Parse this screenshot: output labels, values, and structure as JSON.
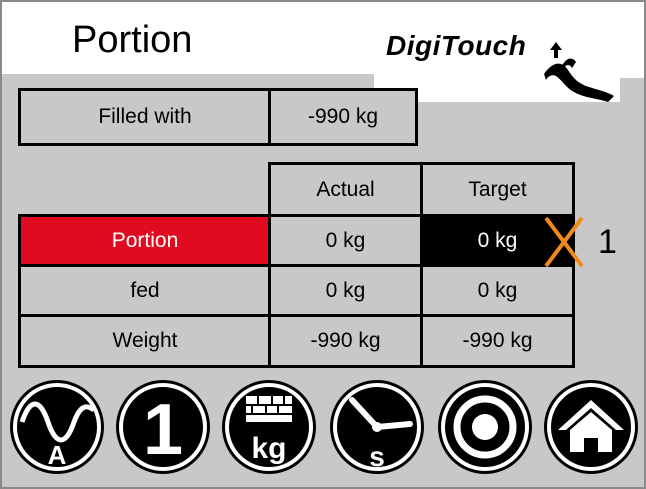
{
  "header": {
    "title": "Portion",
    "brand": "DigiTouch"
  },
  "filled": {
    "label": "Filled with",
    "value": "-990 kg"
  },
  "table": {
    "columns": [
      "Actual",
      "Target"
    ],
    "rows": [
      {
        "label": "Portion",
        "actual": "0 kg",
        "target": "0 kg"
      },
      {
        "label": "fed",
        "actual": "0 kg",
        "target": "0 kg"
      },
      {
        "label": "Weight",
        "actual": "-990 kg",
        "target": "-990 kg"
      }
    ]
  },
  "annotation": {
    "label": "1",
    "color": "#f08a1c"
  },
  "toolbar": {
    "buttons": [
      {
        "icon": "sine-ampere-icon",
        "label": "A"
      },
      {
        "icon": "number-one-icon",
        "label": "1"
      },
      {
        "icon": "bricks-kg-icon",
        "label": "kg"
      },
      {
        "icon": "clock-seconds-icon",
        "label": "s"
      },
      {
        "icon": "target-icon"
      },
      {
        "icon": "home-icon"
      }
    ]
  },
  "colors": {
    "background": "#c8c8c8",
    "highlight_red": "#e10b21",
    "cell_border": "#000000"
  }
}
